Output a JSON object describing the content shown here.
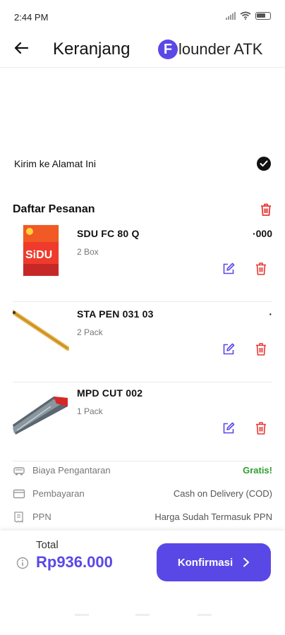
{
  "status_bar": {
    "time": "2:44 PM",
    "battery": "60"
  },
  "header": {
    "title": "Keranjang",
    "brand_letter": "F",
    "brand_text": "lounder ATK"
  },
  "shipping": {
    "label": "Kirim ke Alamat Ini"
  },
  "orders": {
    "title": "Daftar Pesanan",
    "items": [
      {
        "name": "SDU FC 80 Q",
        "qty": "2 Box",
        "price": "·000"
      },
      {
        "name": "STA PEN 031 03",
        "qty": "2 Pack",
        "price": "·"
      },
      {
        "name": "MPD CUT 002",
        "qty": "1 Pack",
        "price": ""
      }
    ]
  },
  "summary": [
    {
      "label": "Biaya Pengantaran",
      "value": "Gratis!",
      "icon": "truck-icon"
    },
    {
      "label": "Pembayaran",
      "value": "Cash on Delivery (COD)",
      "icon": "card-icon"
    },
    {
      "label": "PPN",
      "value": "Harga Sudah Termasuk PPN",
      "icon": "receipt-icon"
    }
  ],
  "footer": {
    "total_label": "Total",
    "total_value": "Rp936.000",
    "confirm_label": "Konfirmasi"
  },
  "colors": {
    "accent": "#5a48e6",
    "danger": "#e53935",
    "success": "#2f9e2f"
  }
}
